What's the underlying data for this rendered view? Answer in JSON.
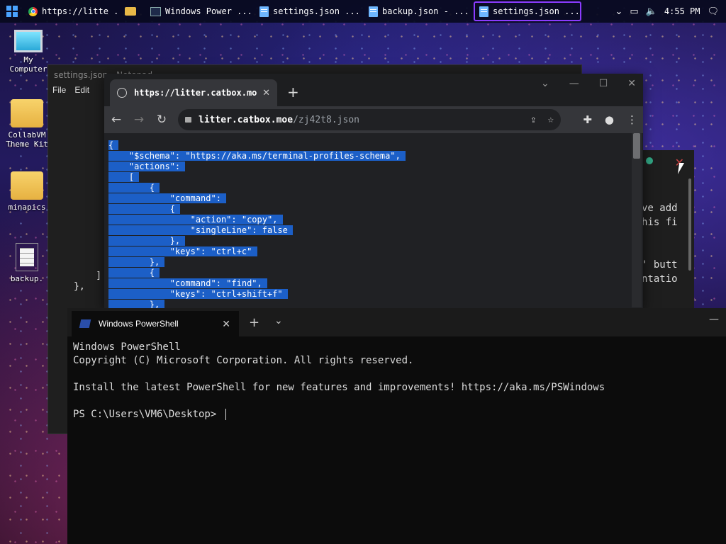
{
  "taskbar": {
    "tasks": [
      {
        "icon": "chrome-icon",
        "label": "https://litte ..."
      },
      {
        "icon": "folder-icon",
        "label": ""
      },
      {
        "icon": "powershell-icon",
        "label": "Windows Power ..."
      },
      {
        "icon": "notepad-icon",
        "label": "settings.json ..."
      },
      {
        "icon": "notepad-icon",
        "label": "backup.json - ..."
      },
      {
        "icon": "notepad-icon",
        "label": "settings.json ..."
      }
    ],
    "tray": {
      "time": "4:55 PM"
    },
    "accent": "#8b3bff"
  },
  "desktop": {
    "icons": [
      {
        "label": "My Computer"
      },
      {
        "label": "CollabVM Theme Kit"
      },
      {
        "label": "minapics"
      },
      {
        "label": "backup."
      }
    ]
  },
  "notepad": {
    "title": "settings.json - Notepad",
    "menu": [
      "File",
      "Edit"
    ],
    "lines": [
      "    ]",
      "},"
    ]
  },
  "right_window": {
    "lines": [
      "ve add",
      "his fi",
      "",
      "' butt",
      "ntatio"
    ]
  },
  "chrome": {
    "tab_title": "https://litter.catbox.moe",
    "url_host": "litter.catbox.moe",
    "url_path": "/zj42t8.json",
    "json_lines": [
      "{",
      "    \"$schema\": \"https://aka.ms/terminal-profiles-schema\",",
      "    \"actions\":",
      "    [",
      "        {",
      "            \"command\":",
      "            {",
      "                \"action\": \"copy\",",
      "                \"singleLine\": false",
      "            },",
      "            \"keys\": \"ctrl+c\"",
      "        },",
      "        {",
      "            \"command\": \"find\",",
      "            \"keys\": \"ctrl+shift+f\"",
      "        },"
    ],
    "selection_color": "#1c5fc7"
  },
  "powershell": {
    "tab_title": "Windows PowerShell",
    "lines": [
      "Windows PowerShell",
      "Copyright (C) Microsoft Corporation. All rights reserved.",
      "",
      "Install the latest PowerShell for new features and improvements! https://aka.ms/PSWindows",
      "",
      "PS C:\\Users\\VM6\\Desktop> "
    ]
  }
}
